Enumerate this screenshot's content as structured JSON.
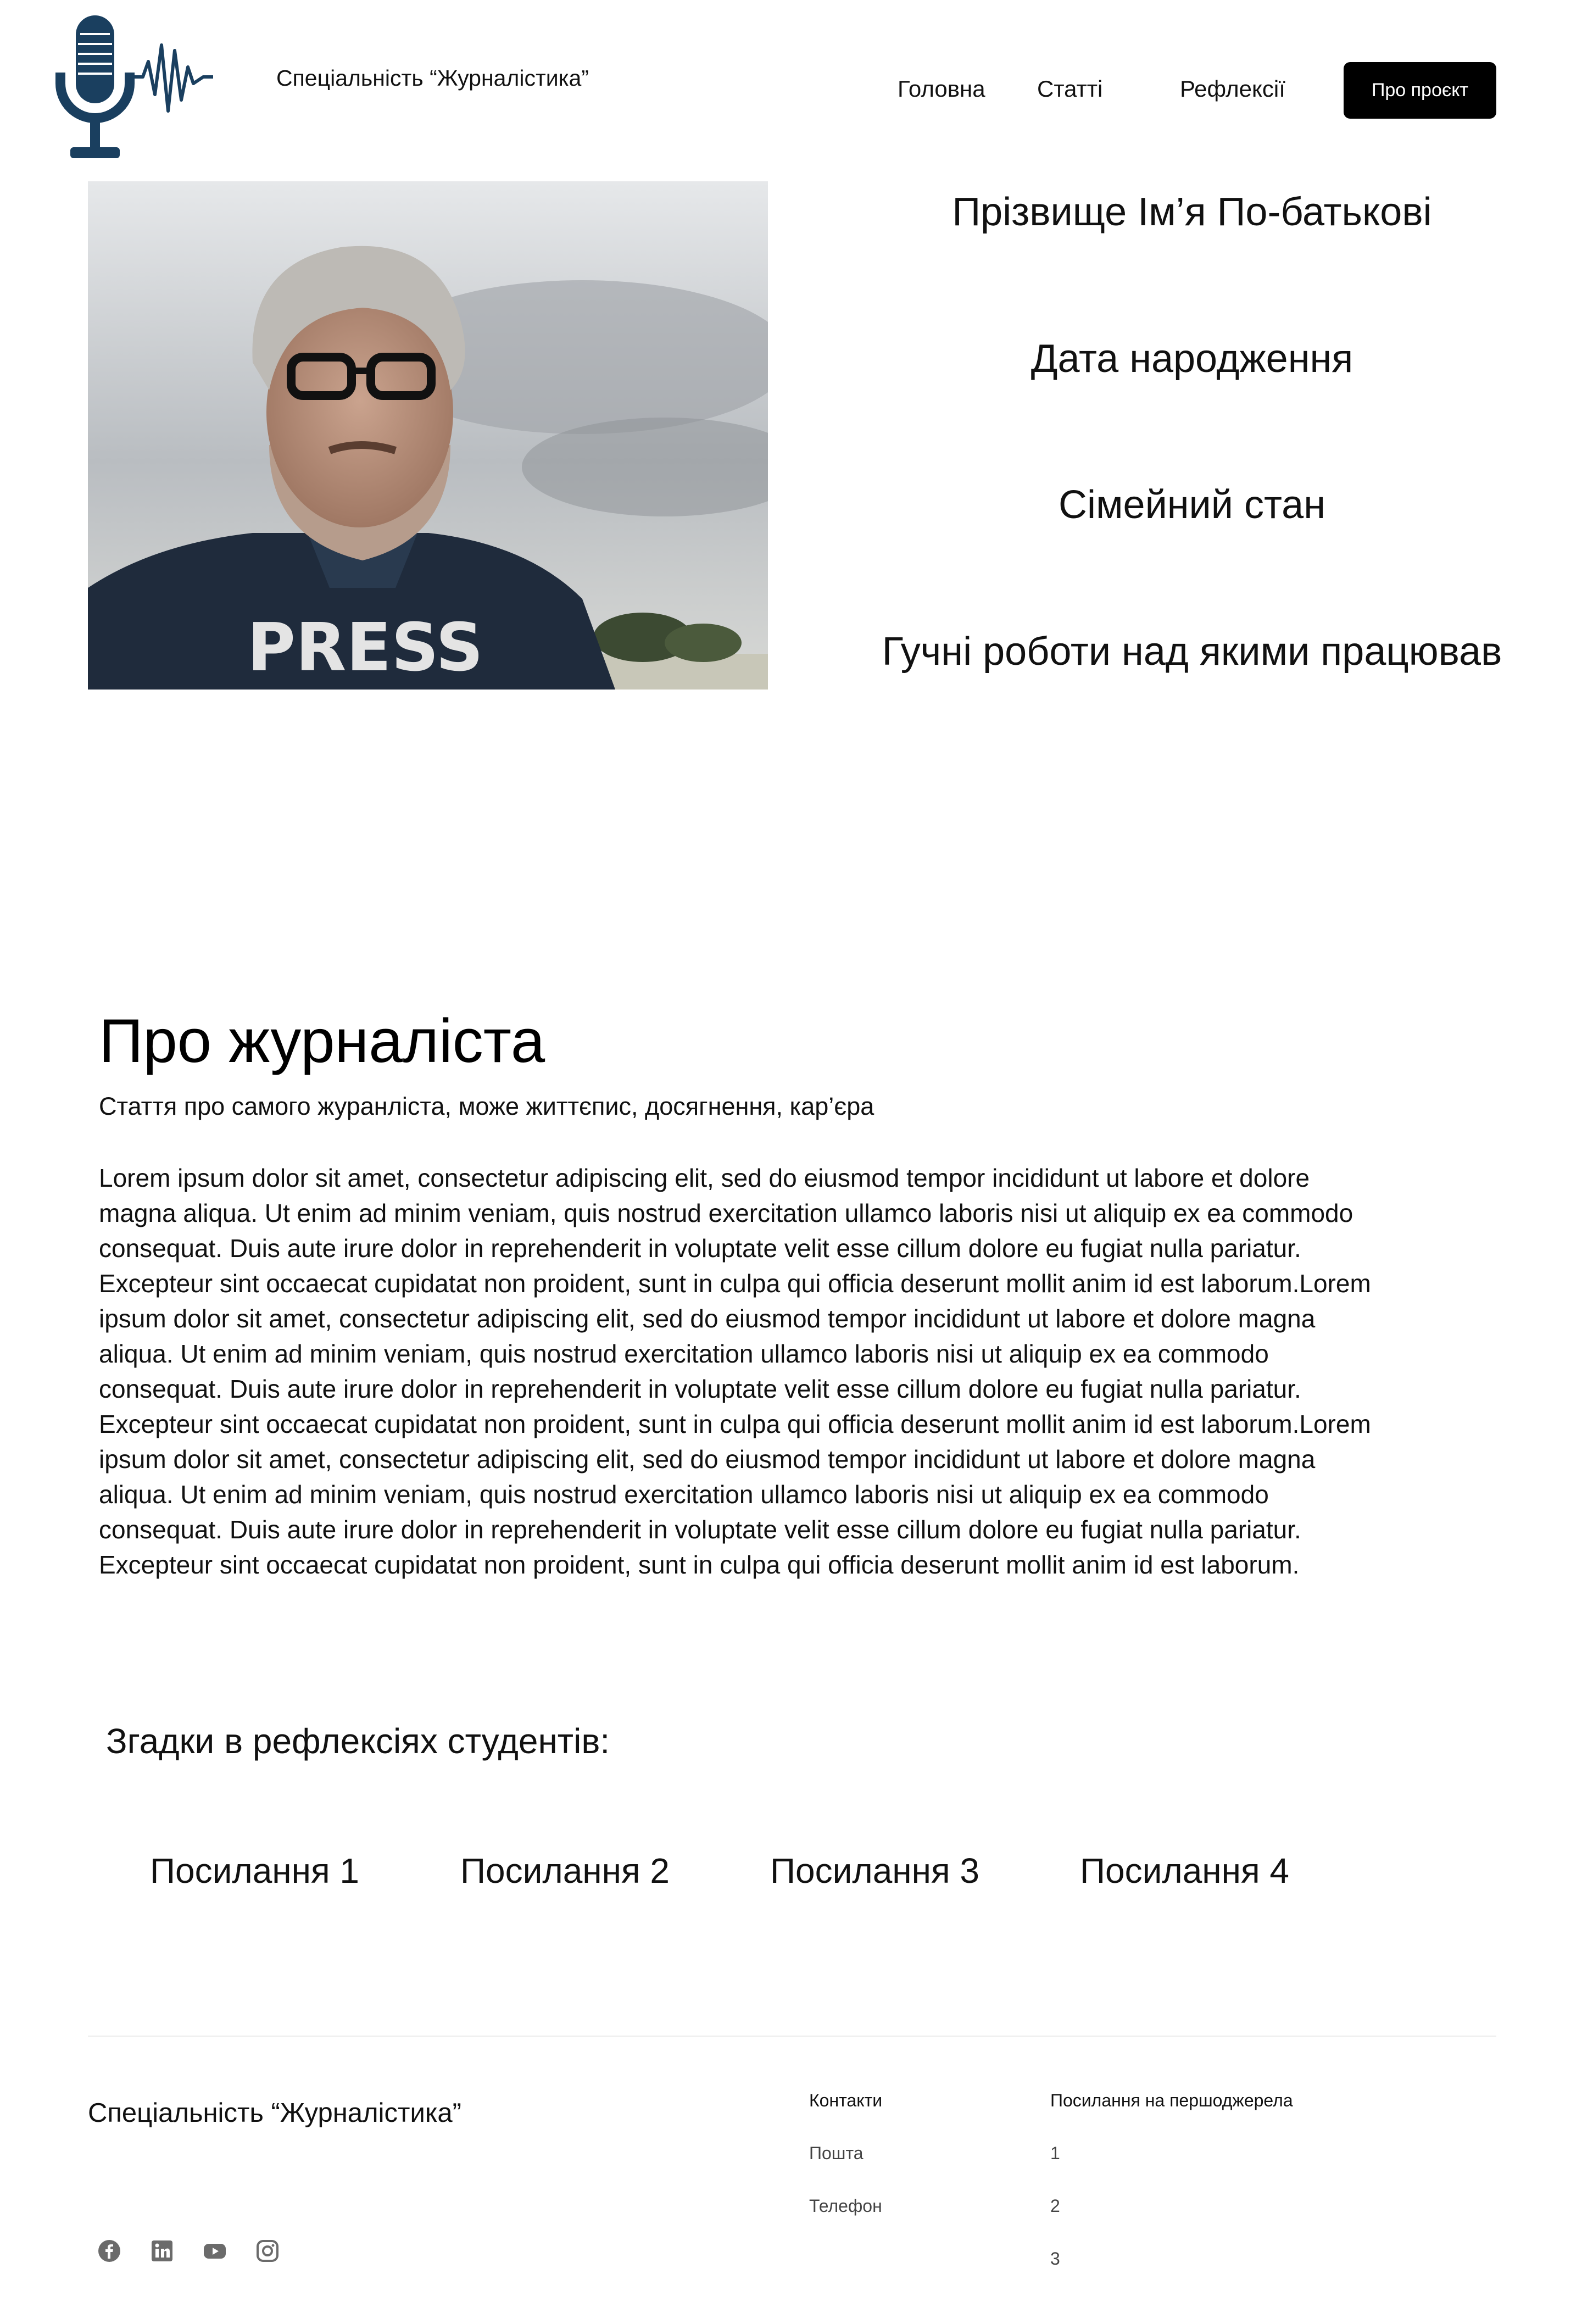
{
  "header": {
    "site_title": "Спеціальність “Журналістика”",
    "nav": [
      {
        "label": "Головна"
      },
      {
        "label": "Статті"
      },
      {
        "label": "Рефлексії"
      }
    ],
    "cta_label": "Про проєкт"
  },
  "hero": {
    "photo_text": "PRESS",
    "info": [
      "Прізвище Ім’я По-батькові",
      "Дата народження",
      "Сімейний стан",
      "Гучні роботи над якими працював"
    ]
  },
  "about": {
    "heading": "Про журналіста",
    "subtitle": "Стаття про самого журанліста, може життєпис, досягнення, кар’єра",
    "body": "Lorem ipsum dolor sit amet, consectetur adipiscing elit, sed do eiusmod tempor incididunt ut labore et dolore magna aliqua. Ut enim ad minim veniam, quis nostrud exercitation ullamco laboris nisi ut aliquip ex ea commodo consequat. Duis aute irure dolor in reprehenderit in voluptate velit esse cillum dolore eu fugiat nulla pariatur. Excepteur sint occaecat cupidatat non proident, sunt in culpa qui officia deserunt mollit anim id est laborum.Lorem ipsum dolor sit amet, consectetur adipiscing elit, sed do eiusmod tempor incididunt ut labore et dolore magna aliqua. Ut enim ad minim veniam, quis nostrud exercitation ullamco laboris nisi ut aliquip ex ea commodo consequat. Duis aute irure dolor in reprehenderit in voluptate velit esse cillum dolore eu fugiat nulla pariatur. Excepteur sint occaecat cupidatat non proident, sunt in culpa qui officia deserunt mollit anim id est laborum.Lorem ipsum dolor sit amet, consectetur adipiscing elit, sed do eiusmod tempor incididunt ut labore et dolore magna aliqua. Ut enim ad minim veniam, quis nostrud exercitation ullamco laboris nisi ut aliquip ex ea commodo consequat. Duis aute irure dolor in reprehenderit in voluptate velit esse cillum dolore eu fugiat nulla pariatur. Excepteur sint occaecat cupidatat non proident, sunt in culpa qui officia deserunt mollit anim id est laborum."
  },
  "mentions": {
    "heading": "Згадки в рефлексіях студентів:",
    "links": [
      "Посилання 1",
      "Посилання 2",
      "Посилання 3",
      "Посилання 4"
    ]
  },
  "footer": {
    "title": "Спеціальність “Журналістика”",
    "contacts": {
      "heading": "Контакти",
      "items": [
        "Пошта",
        "Телефон"
      ]
    },
    "sources": {
      "heading": "Посилання на першоджерела",
      "items": [
        "1",
        "2",
        "3"
      ]
    },
    "social_icons": [
      "facebook-icon",
      "linkedin-icon",
      "youtube-icon",
      "instagram-icon"
    ]
  },
  "colors": {
    "logo": "#1a3f5f",
    "cta_bg": "#000000",
    "divider": "#ececec"
  }
}
